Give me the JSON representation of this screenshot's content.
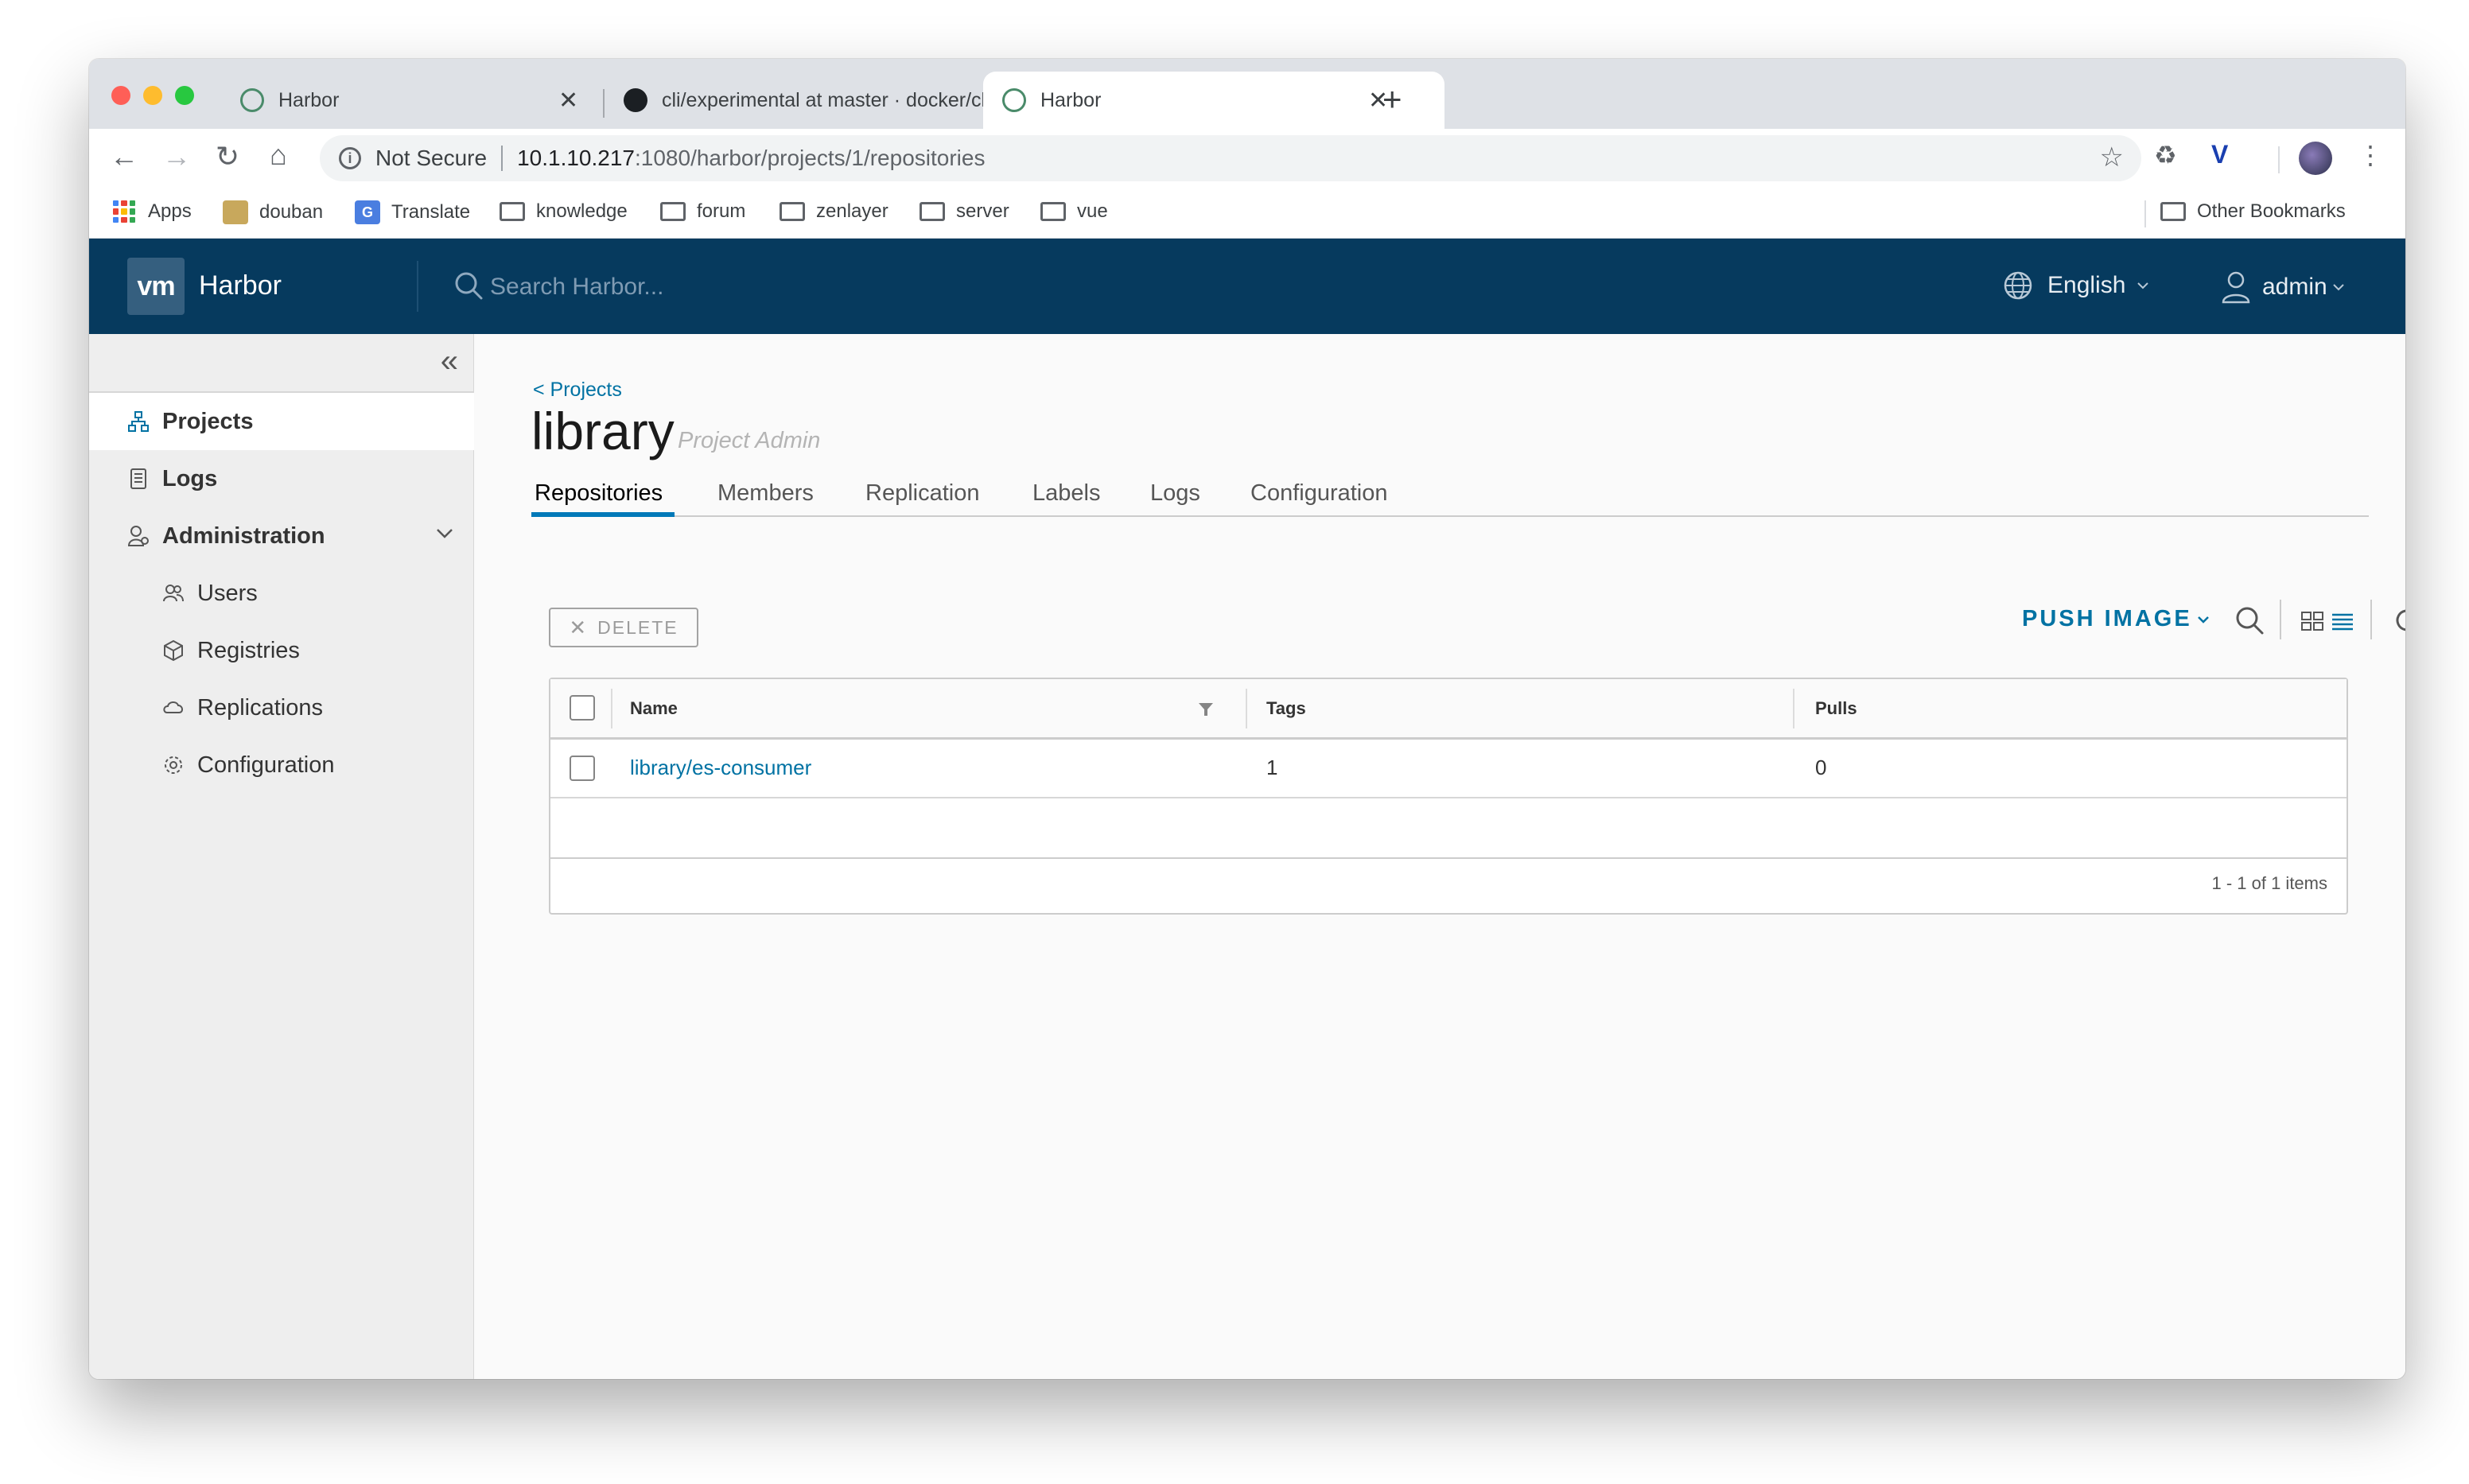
{
  "browser": {
    "tabs": [
      {
        "title": "Harbor",
        "close": "✕"
      },
      {
        "title": "cli/experimental at master · docker/cli",
        "close": "✕"
      },
      {
        "title": "Harbor",
        "close": "✕"
      }
    ],
    "new_tab": "+",
    "security_label": "Not Secure",
    "url_host": "10.1.10.217",
    "url_path": ":1080/harbor/projects/1/repositories",
    "bookmarks": [
      "Apps",
      "douban",
      "Translate",
      "knowledge",
      "forum",
      "zenlayer",
      "server",
      "vue"
    ],
    "other_bookmarks": "Other Bookmarks"
  },
  "header": {
    "logo": "vm",
    "brand": "Harbor",
    "search_placeholder": "Search Harbor...",
    "language": "English",
    "user": "admin"
  },
  "sidebar": {
    "items": [
      {
        "label": "Projects",
        "icon": "projects-icon"
      },
      {
        "label": "Logs",
        "icon": "logs-icon"
      },
      {
        "label": "Administration",
        "icon": "administration-icon"
      }
    ],
    "admin_items": [
      {
        "label": "Users",
        "icon": "users-icon"
      },
      {
        "label": "Registries",
        "icon": "registries-icon"
      },
      {
        "label": "Replications",
        "icon": "replications-icon"
      },
      {
        "label": "Configuration",
        "icon": "configuration-icon"
      }
    ]
  },
  "project": {
    "breadcrumb": "< Projects",
    "name": "library",
    "role": "Project Admin",
    "tabs": [
      "Repositories",
      "Members",
      "Replication",
      "Labels",
      "Logs",
      "Configuration"
    ],
    "active_tab": "Repositories"
  },
  "toolbar": {
    "delete_label": "DELETE",
    "push_label": "PUSH IMAGE"
  },
  "table": {
    "columns": [
      "Name",
      "Tags",
      "Pulls"
    ],
    "rows": [
      {
        "name": "library/es-consumer",
        "tags": "1",
        "pulls": "0"
      }
    ],
    "footer": "1 - 1 of 1 items"
  },
  "colors": {
    "header_bg": "#063a5e",
    "link": "#0072a3",
    "active_tab_underline": "#0079b8"
  }
}
